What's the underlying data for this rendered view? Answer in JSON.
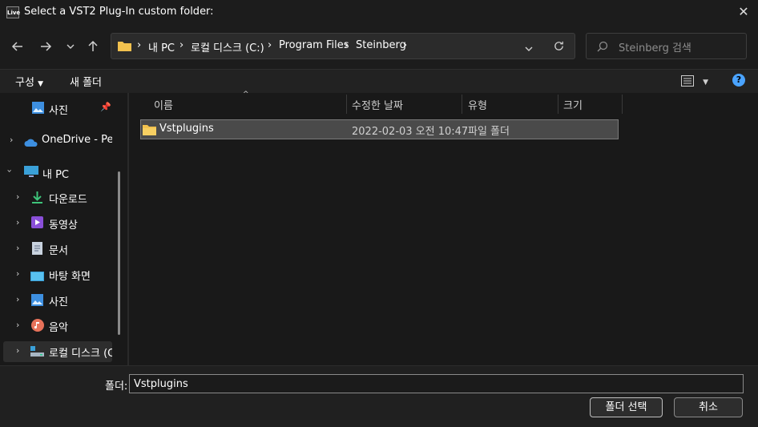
{
  "window": {
    "app_icon_text": "Live",
    "title": "Select a VST2 Plug-In custom folder:"
  },
  "breadcrumb": [
    "내 PC",
    "로컬 디스크 (C:)",
    "Program Files",
    "Steinberg"
  ],
  "search": {
    "placeholder": "Steinberg 검색"
  },
  "toolbar": {
    "organize": "구성",
    "new_folder": "새 폴더"
  },
  "sidebar": {
    "items": [
      {
        "label": "사진"
      },
      {
        "label": "OneDrive - Perso"
      },
      {
        "label": "내 PC"
      },
      {
        "label": "다운로드"
      },
      {
        "label": "동영상"
      },
      {
        "label": "문서"
      },
      {
        "label": "바탕 화면"
      },
      {
        "label": "사진"
      },
      {
        "label": "음악"
      },
      {
        "label": "로컬 디스크 (C"
      }
    ]
  },
  "columns": {
    "name": "이름",
    "modified": "수정한 날짜",
    "type": "유형",
    "size": "크기"
  },
  "files": [
    {
      "name": "Vstplugins",
      "modified": "2022-02-03 오전 10:47",
      "type": "파일 폴더",
      "size": ""
    }
  ],
  "footer": {
    "folder_label": "폴더:",
    "folder_value": "Vstplugins",
    "select_button": "폴더 선택",
    "cancel_button": "취소"
  },
  "colors": {
    "folder": "#f2c14e",
    "accent": "#4aa3ff"
  }
}
